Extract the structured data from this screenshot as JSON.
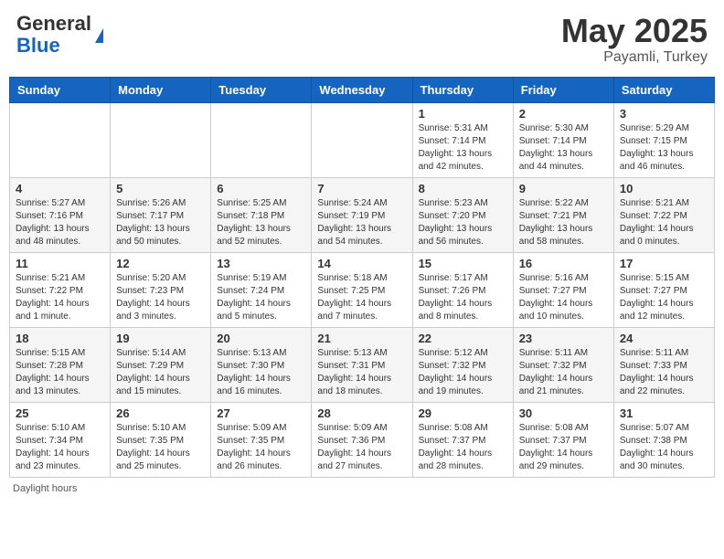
{
  "header": {
    "logo_general": "General",
    "logo_blue": "Blue",
    "title_month": "May 2025",
    "title_location": "Payamli, Turkey"
  },
  "days_of_week": [
    "Sunday",
    "Monday",
    "Tuesday",
    "Wednesday",
    "Thursday",
    "Friday",
    "Saturday"
  ],
  "weeks": [
    [
      {
        "num": "",
        "info": ""
      },
      {
        "num": "",
        "info": ""
      },
      {
        "num": "",
        "info": ""
      },
      {
        "num": "",
        "info": ""
      },
      {
        "num": "1",
        "info": "Sunrise: 5:31 AM\nSunset: 7:14 PM\nDaylight: 13 hours\nand 42 minutes."
      },
      {
        "num": "2",
        "info": "Sunrise: 5:30 AM\nSunset: 7:14 PM\nDaylight: 13 hours\nand 44 minutes."
      },
      {
        "num": "3",
        "info": "Sunrise: 5:29 AM\nSunset: 7:15 PM\nDaylight: 13 hours\nand 46 minutes."
      }
    ],
    [
      {
        "num": "4",
        "info": "Sunrise: 5:27 AM\nSunset: 7:16 PM\nDaylight: 13 hours\nand 48 minutes."
      },
      {
        "num": "5",
        "info": "Sunrise: 5:26 AM\nSunset: 7:17 PM\nDaylight: 13 hours\nand 50 minutes."
      },
      {
        "num": "6",
        "info": "Sunrise: 5:25 AM\nSunset: 7:18 PM\nDaylight: 13 hours\nand 52 minutes."
      },
      {
        "num": "7",
        "info": "Sunrise: 5:24 AM\nSunset: 7:19 PM\nDaylight: 13 hours\nand 54 minutes."
      },
      {
        "num": "8",
        "info": "Sunrise: 5:23 AM\nSunset: 7:20 PM\nDaylight: 13 hours\nand 56 minutes."
      },
      {
        "num": "9",
        "info": "Sunrise: 5:22 AM\nSunset: 7:21 PM\nDaylight: 13 hours\nand 58 minutes."
      },
      {
        "num": "10",
        "info": "Sunrise: 5:21 AM\nSunset: 7:22 PM\nDaylight: 14 hours\nand 0 minutes."
      }
    ],
    [
      {
        "num": "11",
        "info": "Sunrise: 5:21 AM\nSunset: 7:22 PM\nDaylight: 14 hours\nand 1 minute."
      },
      {
        "num": "12",
        "info": "Sunrise: 5:20 AM\nSunset: 7:23 PM\nDaylight: 14 hours\nand 3 minutes."
      },
      {
        "num": "13",
        "info": "Sunrise: 5:19 AM\nSunset: 7:24 PM\nDaylight: 14 hours\nand 5 minutes."
      },
      {
        "num": "14",
        "info": "Sunrise: 5:18 AM\nSunset: 7:25 PM\nDaylight: 14 hours\nand 7 minutes."
      },
      {
        "num": "15",
        "info": "Sunrise: 5:17 AM\nSunset: 7:26 PM\nDaylight: 14 hours\nand 8 minutes."
      },
      {
        "num": "16",
        "info": "Sunrise: 5:16 AM\nSunset: 7:27 PM\nDaylight: 14 hours\nand 10 minutes."
      },
      {
        "num": "17",
        "info": "Sunrise: 5:15 AM\nSunset: 7:27 PM\nDaylight: 14 hours\nand 12 minutes."
      }
    ],
    [
      {
        "num": "18",
        "info": "Sunrise: 5:15 AM\nSunset: 7:28 PM\nDaylight: 14 hours\nand 13 minutes."
      },
      {
        "num": "19",
        "info": "Sunrise: 5:14 AM\nSunset: 7:29 PM\nDaylight: 14 hours\nand 15 minutes."
      },
      {
        "num": "20",
        "info": "Sunrise: 5:13 AM\nSunset: 7:30 PM\nDaylight: 14 hours\nand 16 minutes."
      },
      {
        "num": "21",
        "info": "Sunrise: 5:13 AM\nSunset: 7:31 PM\nDaylight: 14 hours\nand 18 minutes."
      },
      {
        "num": "22",
        "info": "Sunrise: 5:12 AM\nSunset: 7:32 PM\nDaylight: 14 hours\nand 19 minutes."
      },
      {
        "num": "23",
        "info": "Sunrise: 5:11 AM\nSunset: 7:32 PM\nDaylight: 14 hours\nand 21 minutes."
      },
      {
        "num": "24",
        "info": "Sunrise: 5:11 AM\nSunset: 7:33 PM\nDaylight: 14 hours\nand 22 minutes."
      }
    ],
    [
      {
        "num": "25",
        "info": "Sunrise: 5:10 AM\nSunset: 7:34 PM\nDaylight: 14 hours\nand 23 minutes."
      },
      {
        "num": "26",
        "info": "Sunrise: 5:10 AM\nSunset: 7:35 PM\nDaylight: 14 hours\nand 25 minutes."
      },
      {
        "num": "27",
        "info": "Sunrise: 5:09 AM\nSunset: 7:35 PM\nDaylight: 14 hours\nand 26 minutes."
      },
      {
        "num": "28",
        "info": "Sunrise: 5:09 AM\nSunset: 7:36 PM\nDaylight: 14 hours\nand 27 minutes."
      },
      {
        "num": "29",
        "info": "Sunrise: 5:08 AM\nSunset: 7:37 PM\nDaylight: 14 hours\nand 28 minutes."
      },
      {
        "num": "30",
        "info": "Sunrise: 5:08 AM\nSunset: 7:37 PM\nDaylight: 14 hours\nand 29 minutes."
      },
      {
        "num": "31",
        "info": "Sunrise: 5:07 AM\nSunset: 7:38 PM\nDaylight: 14 hours\nand 30 minutes."
      }
    ]
  ],
  "footer": {
    "daylight_label": "Daylight hours"
  }
}
